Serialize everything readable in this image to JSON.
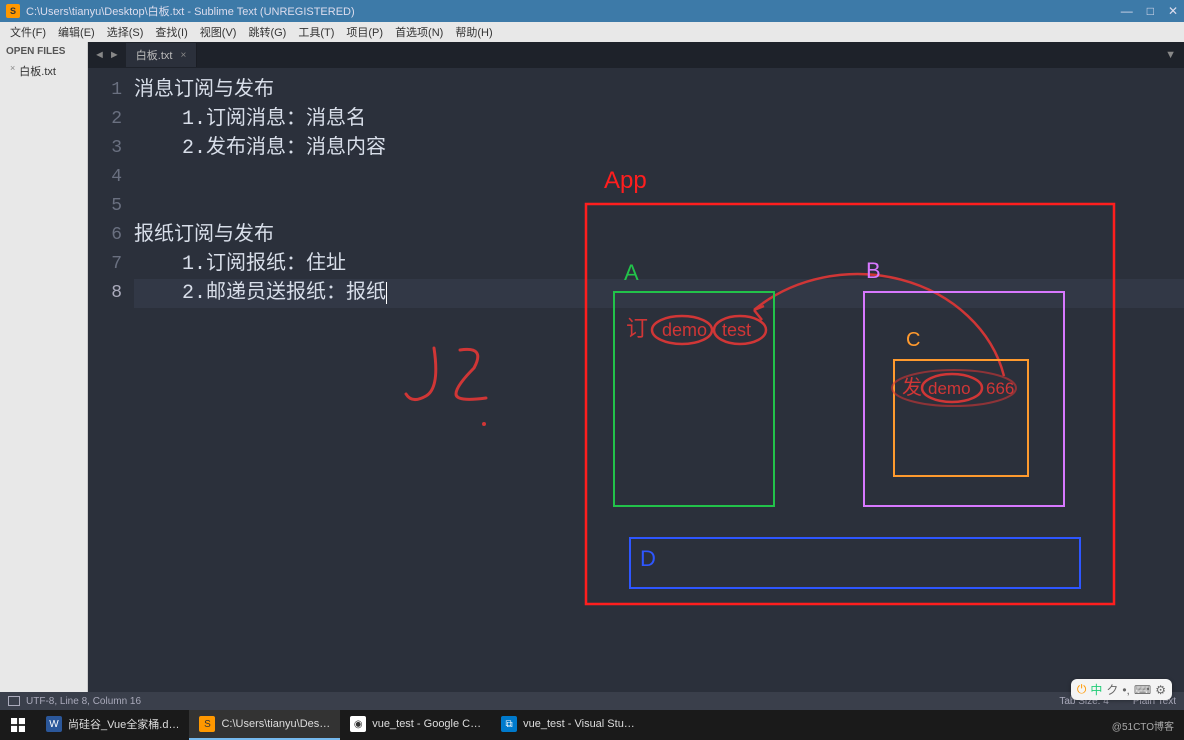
{
  "window": {
    "title": "C:\\Users\\tianyu\\Desktop\\白板.txt - Sublime Text (UNREGISTERED)"
  },
  "menu": {
    "file": "文件(F)",
    "edit": "编辑(E)",
    "select": "选择(S)",
    "find": "查找(I)",
    "view": "视图(V)",
    "goto": "跳转(G)",
    "tools": "工具(T)",
    "project": "项目(P)",
    "preferences": "首选项(N)",
    "help": "帮助(H)"
  },
  "sidebar": {
    "heading": "OPEN FILES",
    "items": [
      {
        "close": "×",
        "name": "白板.txt"
      }
    ]
  },
  "tabs": {
    "nav_left": "◄",
    "nav_right": "►",
    "items": [
      {
        "label": "白板.txt",
        "close": "×"
      }
    ],
    "dropdown": "▼"
  },
  "editor": {
    "gutter": [
      "1",
      "2",
      "3",
      "4",
      "5",
      "6",
      "7",
      "8"
    ],
    "lines": [
      "消息订阅与发布",
      "    1.订阅消息：消息名",
      "    2.发布消息：消息内容",
      "",
      "",
      "报纸订阅与发布",
      "    1.订阅报纸：住址",
      "    2.邮递员送报纸：报纸"
    ],
    "highlight_line_index": 7
  },
  "diagram": {
    "app_label": "App",
    "a_label": "A",
    "b_label": "B",
    "c_label": "C",
    "d_label": "D",
    "a_ann": {
      "prefix": "订",
      "w1": "demo",
      "w2": "test"
    },
    "c_ann": {
      "prefix": "发",
      "w1": "demo",
      "w2": "666"
    },
    "handwriting": "JS"
  },
  "statusbar": {
    "left": "UTF-8, Line 8, Column 16",
    "tab_size": "Tab Size: 4",
    "syntax": "Plain Text"
  },
  "ime": {
    "items": [
      "⏻",
      "中",
      "ク",
      "•,",
      "⌨",
      "⚙"
    ]
  },
  "taskbar": {
    "items": [
      {
        "icon_bg": "#2b579a",
        "icon_fg": "#fff",
        "glyph": "W",
        "label": "尚硅谷_Vue全家桶.d…"
      },
      {
        "icon_bg": "#ff9800",
        "icon_fg": "#333",
        "glyph": "S",
        "label": "C:\\Users\\tianyu\\Des…"
      },
      {
        "icon_bg": "#fff",
        "icon_fg": "#333",
        "glyph": "◉",
        "label": "vue_test - Google C…"
      },
      {
        "icon_bg": "#007acc",
        "icon_fg": "#fff",
        "glyph": "⧉",
        "label": "vue_test - Visual Stu…"
      }
    ],
    "tray": "@51CTO博客"
  },
  "watermark": ""
}
